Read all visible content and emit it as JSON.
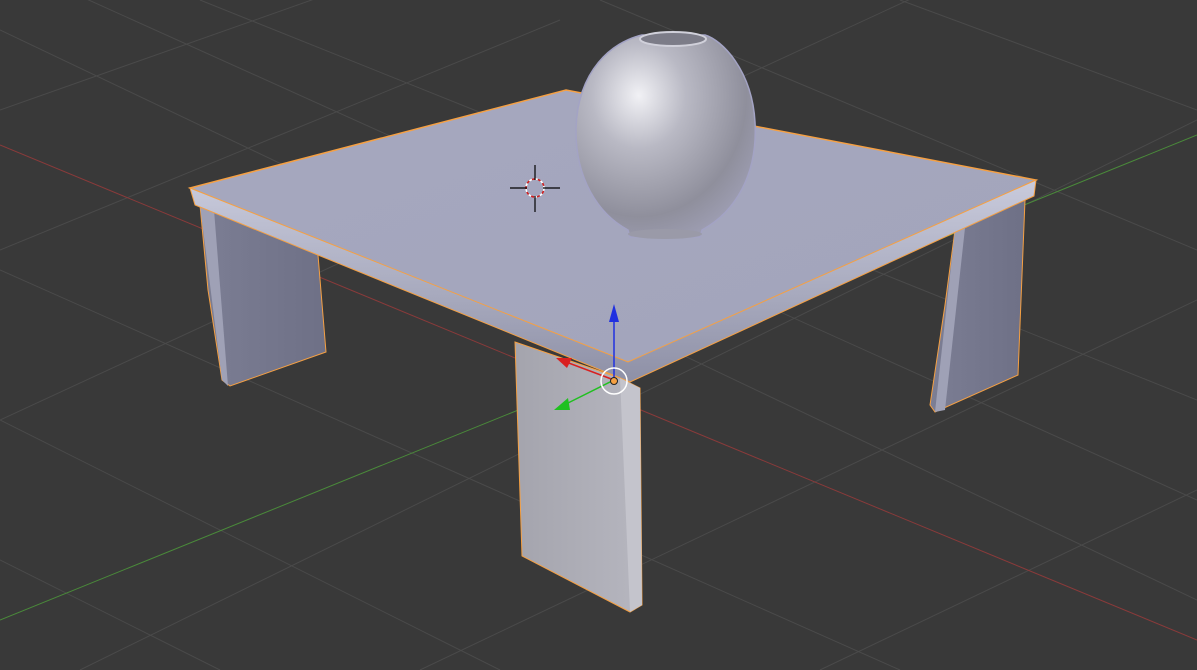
{
  "viewport": {
    "editor": "3D View",
    "background_color": "#393939",
    "grid_color": "#4a4a4a",
    "x_axis_color": "#8a3a3a",
    "y_axis_color": "#4a8a3a"
  },
  "scene": {
    "objects": [
      {
        "name": "table",
        "selected": true,
        "material_color": "#a9abc2",
        "outline_color": "#f5a043"
      },
      {
        "name": "vase",
        "selected": false,
        "material_color": "#b3b3bd"
      }
    ],
    "cursor_3d": {
      "visible": true,
      "icon": "crosshair-icon"
    },
    "manipulator": {
      "visible": true,
      "axes": [
        "x",
        "y",
        "z"
      ],
      "colors": {
        "x": "#d92020",
        "y": "#20c020",
        "z": "#2030e0"
      }
    }
  }
}
